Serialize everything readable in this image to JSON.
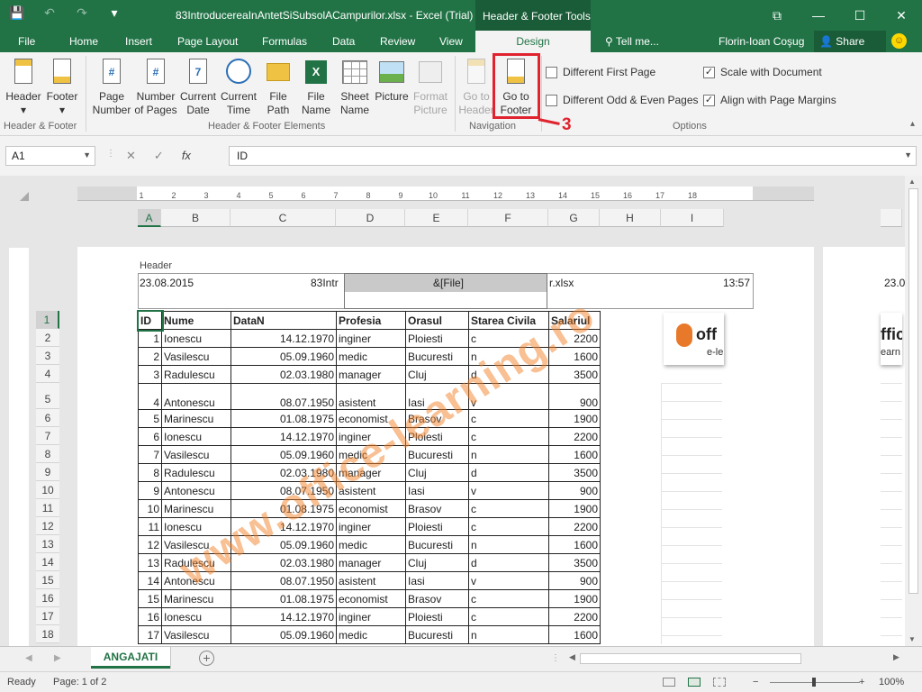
{
  "window": {
    "title": "83IntroducereaInAntetSiSubsolACampurilor.xlsx - Excel (Trial)",
    "context_tab": "Header & Footer Tools",
    "minimize": "—",
    "maximize": "☐",
    "close": "✕",
    "restore_ribbon": "⧉",
    "qat": {
      "save": "💾",
      "undo": "↶",
      "redo": "↷",
      "customize": "▾"
    }
  },
  "tabs": [
    "File",
    "Home",
    "Insert",
    "Page Layout",
    "Formulas",
    "Data",
    "Review",
    "View",
    "Design"
  ],
  "active_tab": "Design",
  "tell_me": "Tell me...",
  "tell_me_icon": "lightbulb-icon",
  "user": "Florin-Ioan Coşug",
  "share": "Share",
  "ribbon": {
    "hf": {
      "header": "Header",
      "footer": "Footer",
      "label": "Header & Footer"
    },
    "elements": {
      "page_number": [
        "Page",
        "Number"
      ],
      "number_of_pages": [
        "Number",
        "of Pages"
      ],
      "current_date": [
        "Current",
        "Date"
      ],
      "current_time": [
        "Current",
        "Time"
      ],
      "file_path": [
        "File",
        "Path"
      ],
      "file_name": [
        "File",
        "Name"
      ],
      "sheet_name": [
        "Sheet",
        "Name"
      ],
      "picture": "Picture",
      "format_picture": [
        "Format",
        "Picture"
      ],
      "label": "Header & Footer Elements"
    },
    "navigation": {
      "go_to_header": [
        "Go to",
        "Header"
      ],
      "go_to_footer": [
        "Go to",
        "Footer"
      ],
      "label": "Navigation"
    },
    "options": {
      "different_first_page": "Different First Page",
      "different_odd_even": "Different Odd & Even Pages",
      "scale_with_document": "Scale with Document",
      "align_with_margins": "Align with Page Margins",
      "label": "Options"
    },
    "callout_number": "3"
  },
  "formula_bar": {
    "name_box": "A1",
    "fx": "fx",
    "cancel": "✕",
    "enter": "✓",
    "content": "ID"
  },
  "ruler_numbers": [
    "1",
    "2",
    "3",
    "4",
    "5",
    "6",
    "7",
    "8",
    "9",
    "10",
    "11",
    "12",
    "13",
    "14",
    "15",
    "16",
    "17",
    "18"
  ],
  "columns": [
    "A",
    "B",
    "C",
    "D",
    "E",
    "F",
    "G",
    "H",
    "I"
  ],
  "rows": [
    "1",
    "2",
    "3",
    "4",
    "5",
    "6",
    "7",
    "8",
    "9",
    "10",
    "11",
    "12",
    "13",
    "14",
    "15",
    "16",
    "17",
    "18"
  ],
  "header_area": {
    "label": "Header",
    "left": "23.08.2015",
    "center_left_fragment": "83Intr",
    "center": "&[File]",
    "center_right_fragment": "r.xlsx",
    "right": "13:57",
    "page2_left": "23.0"
  },
  "table": {
    "headers": [
      "ID",
      "Nume",
      "DataN",
      "Profesia",
      "Orasul",
      "Starea Civila",
      "Salariul"
    ],
    "rows": [
      [
        "1",
        "Ionescu",
        "14.12.1970",
        "inginer",
        "Ploiesti",
        "c",
        "2200"
      ],
      [
        "2",
        "Vasilescu",
        "05.09.1960",
        "medic",
        "Bucuresti",
        "n",
        "1600"
      ],
      [
        "3",
        "Radulescu",
        "02.03.1980",
        "manager",
        "Cluj",
        "d",
        "3500"
      ],
      [
        "4",
        "Antonescu",
        "08.07.1950",
        "asistent",
        "Iasi",
        "v",
        "900"
      ],
      [
        "5",
        "Marinescu",
        "01.08.1975",
        "economist",
        "Brasov",
        "c",
        "1900"
      ],
      [
        "6",
        "Ionescu",
        "14.12.1970",
        "inginer",
        "Ploiesti",
        "c",
        "2200"
      ],
      [
        "7",
        "Vasilescu",
        "05.09.1960",
        "medic",
        "Bucuresti",
        "n",
        "1600"
      ],
      [
        "8",
        "Radulescu",
        "02.03.1980",
        "manager",
        "Cluj",
        "d",
        "3500"
      ],
      [
        "9",
        "Antonescu",
        "08.07.1950",
        "asistent",
        "Iasi",
        "v",
        "900"
      ],
      [
        "10",
        "Marinescu",
        "01.08.1975",
        "economist",
        "Brasov",
        "c",
        "1900"
      ],
      [
        "11",
        "Ionescu",
        "14.12.1970",
        "inginer",
        "Ploiesti",
        "c",
        "2200"
      ],
      [
        "12",
        "Vasilescu",
        "05.09.1960",
        "medic",
        "Bucuresti",
        "n",
        "1600"
      ],
      [
        "13",
        "Radulescu",
        "02.03.1980",
        "manager",
        "Cluj",
        "d",
        "3500"
      ],
      [
        "14",
        "Antonescu",
        "08.07.1950",
        "asistent",
        "Iasi",
        "v",
        "900"
      ],
      [
        "15",
        "Marinescu",
        "01.08.1975",
        "economist",
        "Brasov",
        "c",
        "1900"
      ],
      [
        "16",
        "Ionescu",
        "14.12.1970",
        "inginer",
        "Ploiesti",
        "c",
        "2200"
      ],
      [
        "17",
        "Vasilescu",
        "05.09.1960",
        "medic",
        "Bucuresti",
        "n",
        "1600"
      ]
    ]
  },
  "logo": {
    "text": "off",
    "sub": "e-le",
    "text2": "ffic",
    "sub2": "earn"
  },
  "watermark": "www.office-learning.ro",
  "sheet_tab": "ANGAJATI",
  "add_sheet": "+",
  "status": {
    "ready": "Ready",
    "page": "Page: 1 of 2",
    "zoom_minus": "−",
    "zoom_plus": "+",
    "zoom": "100%"
  },
  "colors": {
    "accent": "#217346",
    "highlight": "#e0232e",
    "watermark": "#f28228"
  }
}
